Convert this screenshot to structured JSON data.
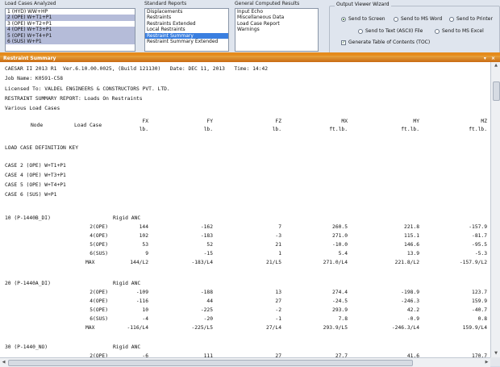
{
  "groups": {
    "load_cases": {
      "title": "Load Cases Analyzed",
      "items": [
        {
          "label": "1 (HYD) WW+HP",
          "state": ""
        },
        {
          "label": "2 (OPE) W+T1+P1",
          "state": "sel"
        },
        {
          "label": "3 (OPE) W+T2+P1",
          "state": ""
        },
        {
          "label": "4 (OPE) W+T3+P1",
          "state": "sel"
        },
        {
          "label": "5 (OPE) W+T4+P1",
          "state": "sel"
        },
        {
          "label": "6 (SUS) W+P1",
          "state": "sel"
        }
      ]
    },
    "standard_reports": {
      "title": "Standard Reports",
      "items": [
        {
          "label": "Displacements",
          "state": ""
        },
        {
          "label": "Restraints",
          "state": ""
        },
        {
          "label": "Restraints Extended",
          "state": ""
        },
        {
          "label": "Local Restraints",
          "state": ""
        },
        {
          "label": "Restraint Summary",
          "state": "hl"
        },
        {
          "label": "Restraint Summary Extended",
          "state": ""
        }
      ]
    },
    "general_results": {
      "title": "General Computed Results",
      "items": [
        {
          "label": "Input Echo",
          "state": ""
        },
        {
          "label": "Miscellaneous Data",
          "state": ""
        },
        {
          "label": "Load Case Report",
          "state": ""
        },
        {
          "label": "Warnings",
          "state": ""
        }
      ]
    }
  },
  "wizard": {
    "title": "Output Viewer Wizard",
    "send_screen": "Send to Screen",
    "send_word": "Send to MS Word",
    "send_printer": "Send to Printer",
    "send_text": "Send to Text (ASCII) File",
    "send_excel": "Send to MS Excel",
    "toc": "Generate Table of Contents (TOC)",
    "selected": "send_screen",
    "toc_checked": true
  },
  "panel": {
    "title": "Restraint Summary",
    "buttons": "▾ ×"
  },
  "report": {
    "header": [
      "CAESAR II 2013 R1  Ver.6.10.00.0025, (Build 121130)   Date: DEC 11, 2013   Time: 14:42",
      "Job Name: K0591-C58",
      "Licensed To: VALDEL ENGINEERS & CONSTRUCTORS PVT. LTD.",
      "RESTRAINT SUMMARY REPORT: Loads On Restraints",
      "Various Load Cases"
    ],
    "col_headers": [
      "Node",
      "Load Case",
      "FX",
      "FY",
      "FZ",
      "MX",
      "MY",
      "MZ"
    ],
    "units": [
      "lb.",
      "lb.",
      "lb.",
      "ft.lb.",
      "ft.lb.",
      "ft.lb."
    ],
    "key_title": "LOAD CASE DEFINITION KEY",
    "key": [
      "CASE 2 (OPE) W+T1+P1",
      "CASE 4 (OPE) W+T3+P1",
      "CASE 5 (OPE) W+T4+P1",
      "CASE 6 (SUS) W+P1"
    ],
    "nodes": [
      {
        "node": "10 (P-1440B_DI)",
        "type": "Rigid ANC",
        "rows": [
          [
            "2(OPE)",
            "144",
            "-162",
            "7",
            "260.5",
            "221.8",
            "-157.9"
          ],
          [
            "4(OPE)",
            "102",
            "-183",
            "-3",
            "271.0",
            "115.1",
            "-81.7"
          ],
          [
            "5(OPE)",
            "53",
            "52",
            "21",
            "-10.0",
            "146.6",
            "-95.5"
          ],
          [
            "6(SUS)",
            "9",
            "-15",
            "1",
            "5.4",
            "13.9",
            "-5.3"
          ],
          [
            "MAX",
            "144/L2",
            "-183/L4",
            "21/L5",
            "271.0/L4",
            "221.8/L2",
            "-157.9/L2"
          ]
        ]
      },
      {
        "node": "20 (P-1440A_DI)",
        "type": "Rigid ANC",
        "rows": [
          [
            "2(OPE)",
            "-109",
            "-188",
            "13",
            "274.4",
            "-198.9",
            "123.7"
          ],
          [
            "4(OPE)",
            "-116",
            "44",
            "27",
            "-24.5",
            "-246.3",
            "159.9"
          ],
          [
            "5(OPE)",
            "10",
            "-225",
            "-2",
            "293.9",
            "42.2",
            "-40.7"
          ],
          [
            "6(SUS)",
            "-4",
            "-20",
            "-1",
            "7.8",
            "-0.9",
            "0.8"
          ],
          [
            "MAX",
            "-116/L4",
            "-225/L5",
            "27/L4",
            "293.9/L5",
            "-246.3/L4",
            "159.9/L4"
          ]
        ]
      },
      {
        "node": "30 (P-1440_NO)",
        "type": "Rigid ANC",
        "rows": [
          [
            "2(OPE)",
            "-6",
            "111",
            "27",
            "27.7",
            "41.6",
            "170.7"
          ]
        ]
      }
    ]
  }
}
